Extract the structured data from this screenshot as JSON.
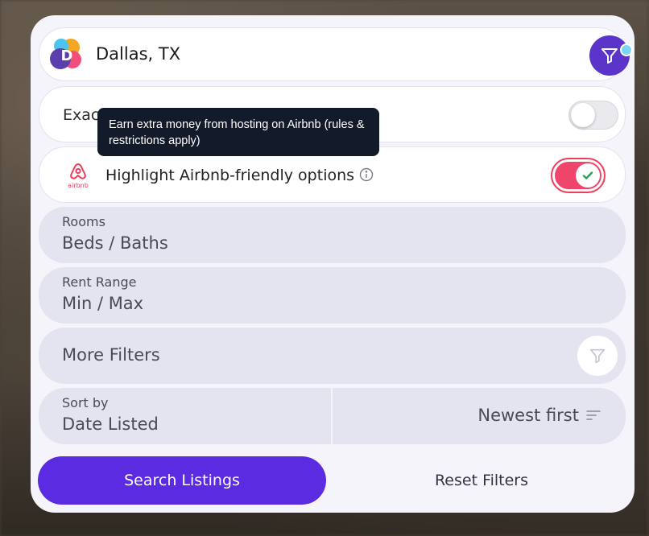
{
  "location": {
    "value": "Dallas, TX",
    "logo_icon": "d-logo",
    "filter_icon": "filter-icon",
    "notification_color": "#7ad6f2"
  },
  "exact": {
    "label": "Exac",
    "toggle_state": "off"
  },
  "tooltip": {
    "text": "Earn extra money from hosting on Airbnb (rules & restrictions apply)"
  },
  "airbnb": {
    "logo_text": "airbnb",
    "label": "Highlight Airbnb-friendly options",
    "info_icon": "info-icon",
    "toggle_state": "on",
    "accent": "#f0456a"
  },
  "rooms": {
    "label": "Rooms",
    "value": "Beds / Baths"
  },
  "rent": {
    "label": "Rent Range",
    "value": "Min / Max"
  },
  "more_filters": {
    "label": "More Filters",
    "icon": "filter-icon"
  },
  "sort": {
    "label": "Sort by",
    "value": "Date Listed",
    "order": "Newest first",
    "order_icon": "sort-lines-icon"
  },
  "actions": {
    "search_label": "Search Listings",
    "reset_label": "Reset Filters",
    "primary_color": "#5a2be0"
  }
}
